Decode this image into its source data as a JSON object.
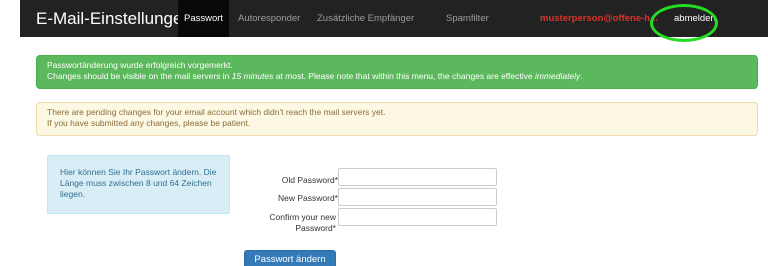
{
  "header": {
    "title": "E-Mail-Einstellungen",
    "tabs": [
      {
        "label": "Passwort",
        "active": true
      },
      {
        "label": "Autoresponder",
        "active": false
      },
      {
        "label": "Zusätzliche Empfänger",
        "active": false
      },
      {
        "label": "Spamfilter",
        "active": false
      }
    ],
    "user_email": "musterperson@offene-h...",
    "logout_label": "abmelden"
  },
  "alerts": {
    "success": {
      "line1": "Passwortänderung wurde erfolgreich vorgemerkt.",
      "line2_a": "Changes should be visible on the mail servers in ",
      "line2_b": "15 minutes",
      "line2_c": " at most. Please note that within this menu, the changes are effective ",
      "line2_d": "immediately",
      "line2_e": "."
    },
    "warning": {
      "line1": "There are pending changes for your email account which didn't reach the mail servers yet.",
      "line2": "If you have submitted any changes, please be patient."
    }
  },
  "help_text": "Hier können Sie Ihr Passwort ändern. Die Länge muss zwischen 8 und 64 Zeichen liegen.",
  "form": {
    "old_password_label": "Old Password*",
    "new_password_label": "New Password*",
    "confirm_password_label": "Confirm your new Password*",
    "old_password_value": "",
    "new_password_value": "",
    "confirm_password_value": "",
    "submit_label": "Passwort ändern"
  },
  "colors": {
    "navbar": "#222222",
    "success": "#5cb85c",
    "warning_bg": "#fcf8e3",
    "info_bg": "#d9edf7",
    "primary": "#337ab7",
    "user_email": "#d9342b",
    "highlight_ring": "#22dd22"
  }
}
